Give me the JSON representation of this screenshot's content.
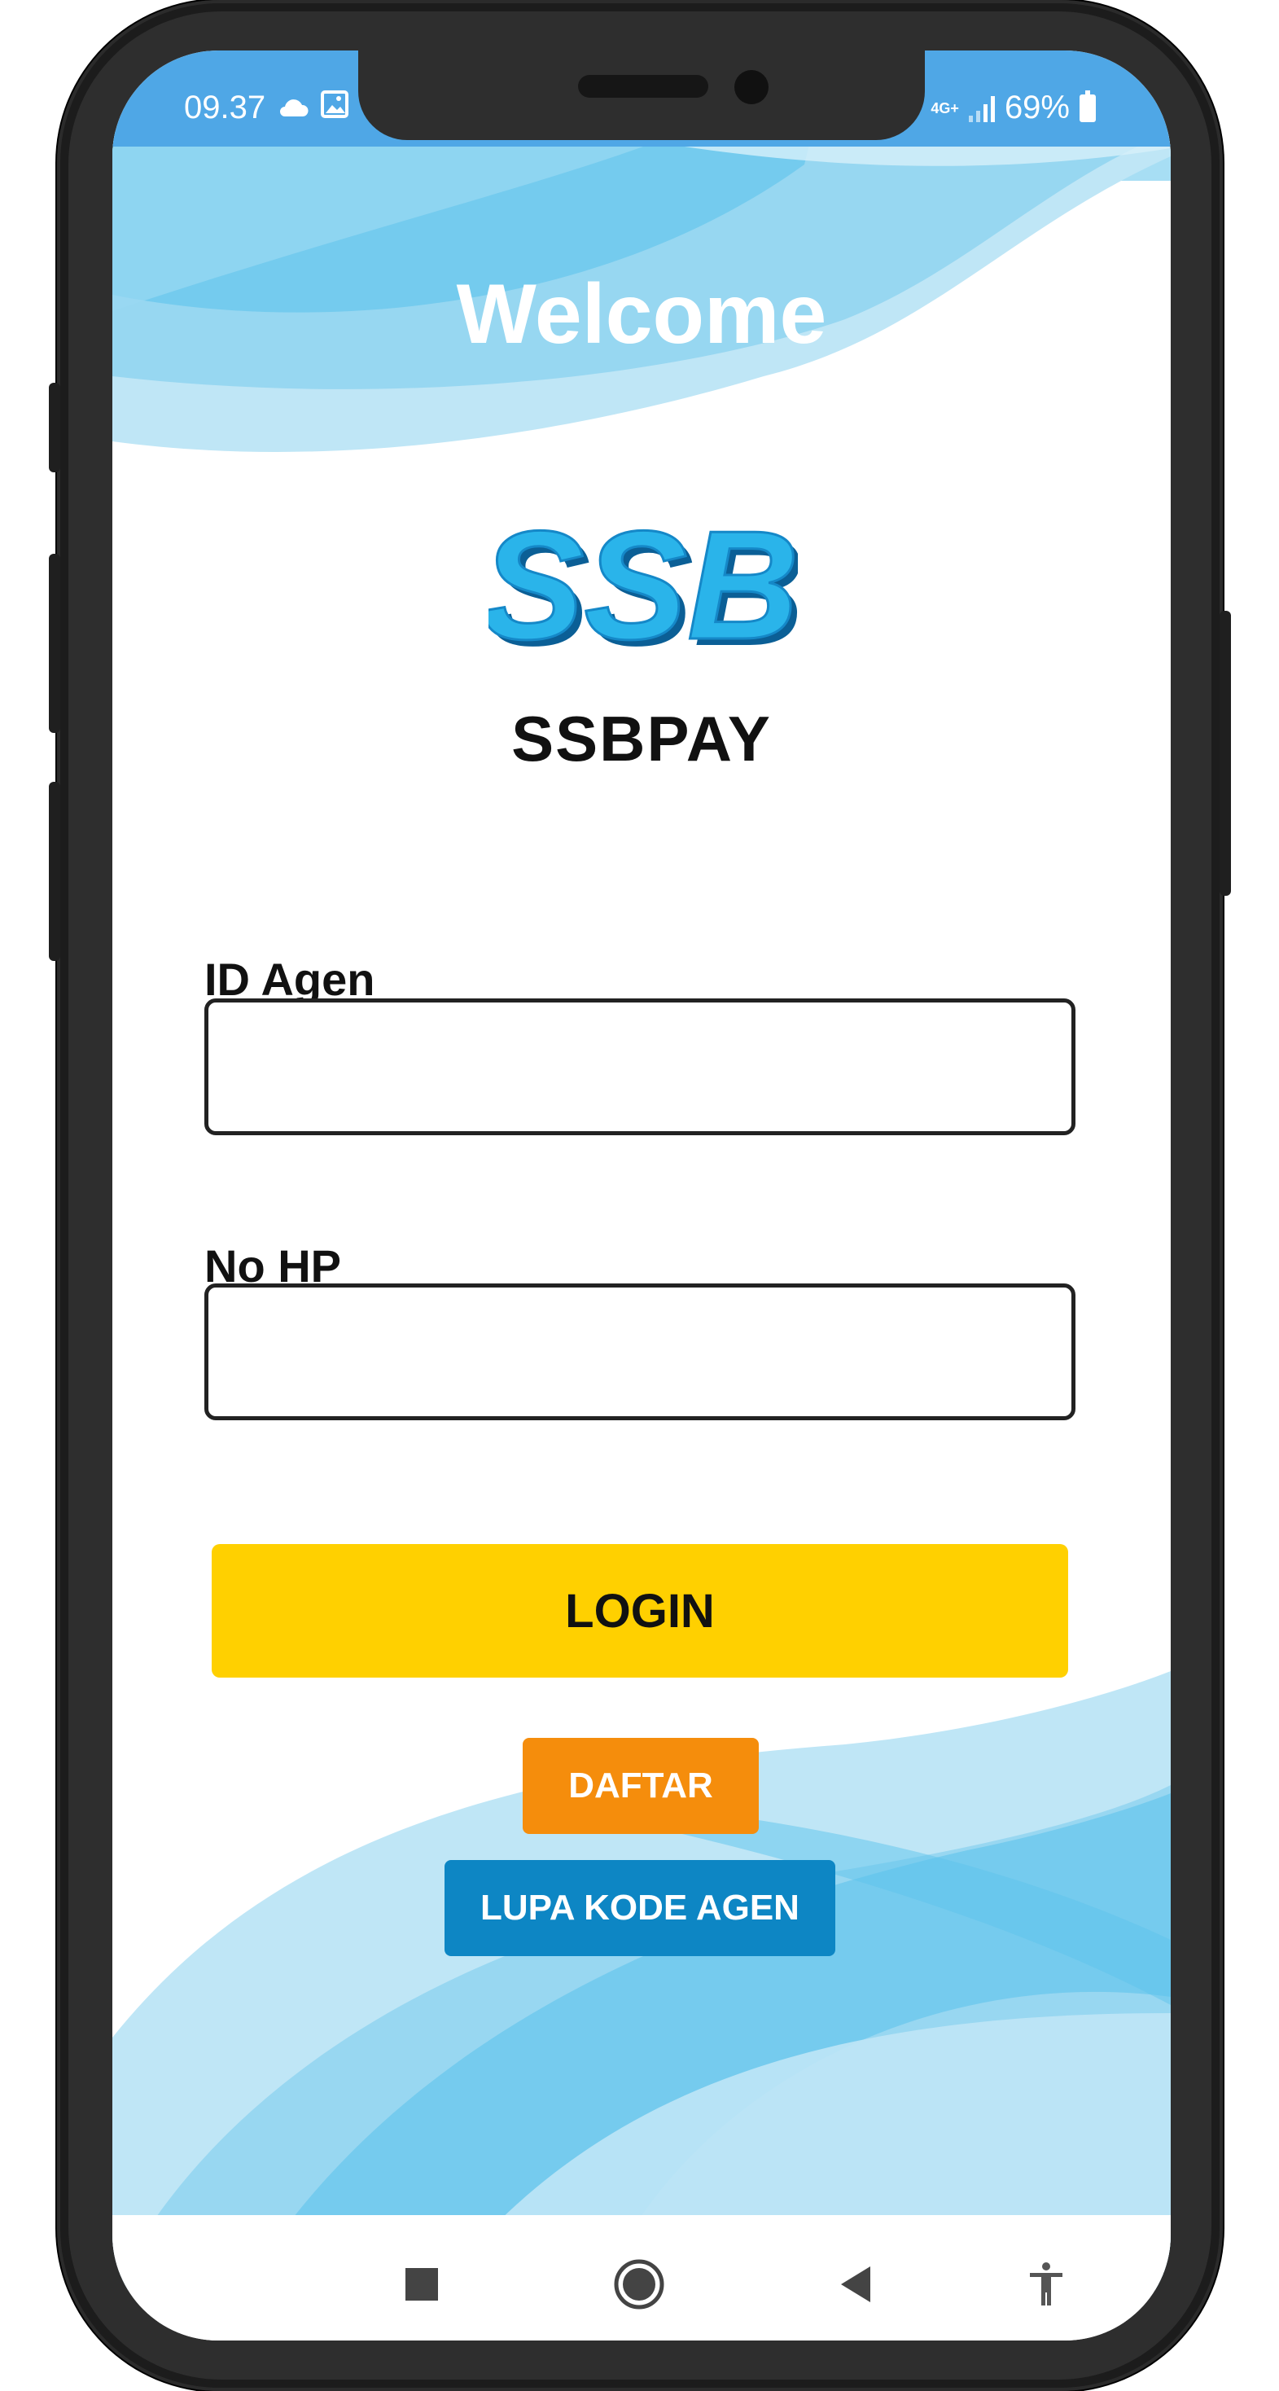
{
  "status_bar": {
    "time": "09.37",
    "network_type": "4G+",
    "battery_percent": "69%",
    "icons": [
      "cloud-icon",
      "image-icon",
      "signal-icon",
      "battery-icon"
    ]
  },
  "header": {
    "welcome_text": "Welcome"
  },
  "brand": {
    "logo_text": "SSB",
    "app_name": "SSBPAY",
    "logo_color": "#2ab4ea"
  },
  "form": {
    "id_agen": {
      "label": "ID Agen",
      "value": "",
      "placeholder": ""
    },
    "no_hp": {
      "label": "No HP",
      "value": "",
      "placeholder": ""
    }
  },
  "buttons": {
    "login": "LOGIN",
    "daftar": "DAFTAR",
    "lupa_kode_agen": "LUPA KODE AGEN"
  },
  "nav_bar": {
    "icons": [
      "recents-icon",
      "home-icon",
      "back-icon",
      "accessibility-icon"
    ]
  },
  "colors": {
    "status_bar": "#4fa7e6",
    "login_button": "#ffd000",
    "daftar_button": "#f58d0c",
    "lupa_button": "#0d86c4",
    "wave_light": "#bfe6f6",
    "wave_mid": "#8fd3f0",
    "wave_dark": "#5ec3ec"
  }
}
